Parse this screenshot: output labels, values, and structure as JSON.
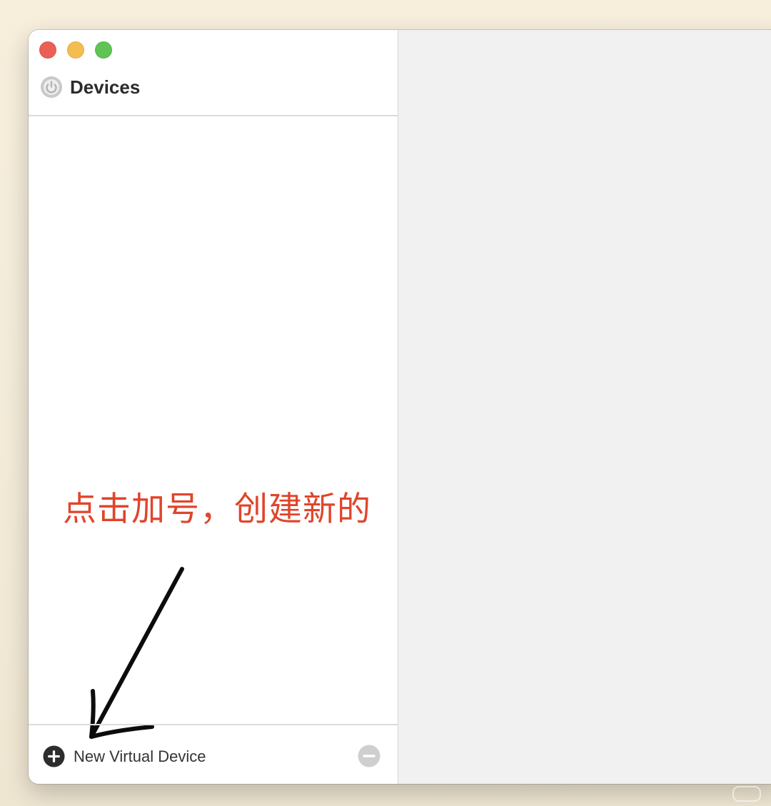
{
  "window": {
    "title": "Devices",
    "controls": {
      "close_color": "#ec5f57",
      "minimize_color": "#f4bd4f",
      "maximize_color": "#5fc454"
    }
  },
  "sidebar": {
    "header_icon": "devices-power-icon",
    "devices": [],
    "footer": {
      "add_label": "New Virtual Device",
      "add_icon": "plus-circle-icon",
      "remove_icon": "minus-circle-icon"
    }
  },
  "annotation": {
    "text": "点击加号，创建新的",
    "color": "#e0452b",
    "arrow_icon": "hand-drawn-arrow-icon"
  }
}
